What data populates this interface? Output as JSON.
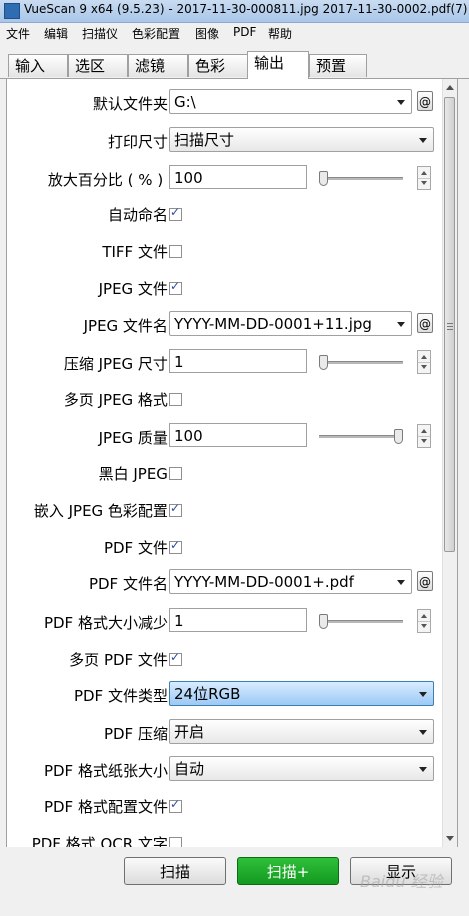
{
  "window": {
    "title": "VueScan 9 x64 (9.5.23) - 2017-11-30-000811.jpg 2017-11-30-0002.pdf(7)"
  },
  "menu": [
    "文件",
    "编辑",
    "扫描仪",
    "色彩配置",
    "图像",
    "PDF",
    "帮助"
  ],
  "tabs": [
    {
      "label": "输入",
      "active": false
    },
    {
      "label": "选区",
      "active": false
    },
    {
      "label": "滤镜",
      "active": false
    },
    {
      "label": "色彩",
      "active": false
    },
    {
      "label": "输出",
      "active": true
    },
    {
      "label": "预置",
      "active": false
    }
  ],
  "fields": {
    "default_folder": {
      "label": "默认文件夹:",
      "value": "G:\\"
    },
    "print_size": {
      "label": "打印尺寸:",
      "value": "扫描尺寸"
    },
    "magnify": {
      "label": "放大百分比 ( % ) :",
      "value": "100",
      "slider": 0.0
    },
    "auto_name": {
      "label": "自动命名:",
      "checked": true
    },
    "tiff_file": {
      "label": "TIFF 文件:",
      "checked": false
    },
    "jpeg_file": {
      "label": "JPEG 文件:",
      "checked": true
    },
    "jpeg_name": {
      "label": "JPEG 文件名:",
      "value": "YYYY-MM-DD-0001+11.jpg"
    },
    "jpeg_compress": {
      "label": "压缩 JPEG 尺寸:",
      "value": "1",
      "slider": 0.0
    },
    "multi_jpeg": {
      "label": "多页 JPEG 格式:",
      "checked": false
    },
    "jpeg_quality": {
      "label": "JPEG 质量:",
      "value": "100",
      "slider": 1.0
    },
    "bw_jpeg": {
      "label": "黑白 JPEG:",
      "checked": false
    },
    "embed_jpeg_profile": {
      "label": "嵌入 JPEG 色彩配置:",
      "checked": true
    },
    "pdf_file": {
      "label": "PDF 文件:",
      "checked": true
    },
    "pdf_name": {
      "label": "PDF 文件名:",
      "value": "YYYY-MM-DD-0001+.pdf"
    },
    "pdf_reduce": {
      "label": "PDF 格式大小减少:",
      "value": "1",
      "slider": 0.0
    },
    "multi_pdf": {
      "label": "多页 PDF 文件:",
      "checked": true
    },
    "pdf_type": {
      "label": "PDF 文件类型:",
      "value": "24位RGB"
    },
    "pdf_compress": {
      "label": "PDF 压缩:",
      "value": "开启"
    },
    "pdf_paper": {
      "label": "PDF 格式纸张大小:",
      "value": "自动"
    },
    "pdf_profile": {
      "label": "PDF 格式配置文件:",
      "checked": true
    },
    "pdf_ocr": {
      "label": "PDF 格式 OCR 文字:",
      "checked": false
    }
  },
  "buttons": {
    "scan": "扫描",
    "scan_plus": "扫描+",
    "preview": "显示"
  },
  "at_symbol": "@",
  "watermark": "Baidu 经验",
  "colors": {
    "accent_green": "#139a20",
    "highlight_blue": "#9cc9f5"
  }
}
